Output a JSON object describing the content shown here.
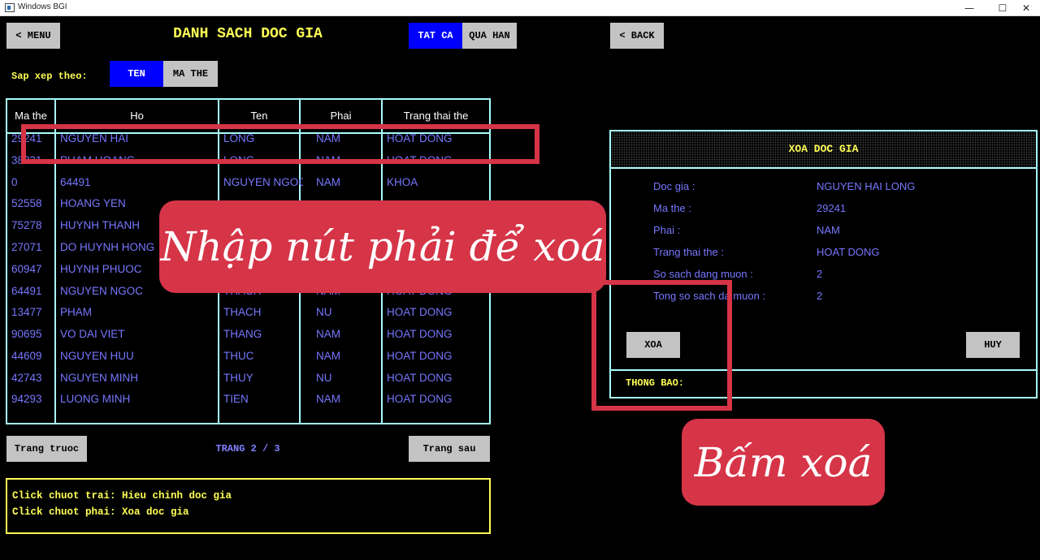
{
  "window": {
    "title": "Windows BGI",
    "minimize": "—",
    "maximize": "☐",
    "close": "✕"
  },
  "nav": {
    "menu_label": "< MENU",
    "back_label": "< BACK"
  },
  "heading": "DANH SACH DOC GIA",
  "filter": {
    "all_label": "TAT CA",
    "overdue_label": "QUA HAN",
    "active": "TAT CA"
  },
  "sort": {
    "label": "Sap xep theo:",
    "name_label": "TEN",
    "card_label": "MA THE",
    "active": "TEN"
  },
  "table": {
    "headers": [
      "Ma the",
      "Ho",
      "Ten",
      "Phai",
      "Trang thai the"
    ],
    "rows": [
      [
        "29241",
        "NGUYEN HAI",
        "LONG",
        "NAM",
        "HOAT DONG"
      ],
      [
        "38231",
        "PHAM HOANG",
        "LONG",
        "NAM",
        "HOAT DONG"
      ],
      [
        "0",
        "64491",
        "NGUYEN NGOC",
        "NAM",
        "KHOA"
      ],
      [
        "52558",
        "HOANG YEN",
        "",
        "",
        ""
      ],
      [
        "75278",
        "HUYNH THANH",
        "",
        "",
        ""
      ],
      [
        "27071",
        "DO HUYNH HONG",
        "",
        "",
        ""
      ],
      [
        "60947",
        "HUYNH PHUOC",
        "",
        "",
        ""
      ],
      [
        "64491",
        "NGUYEN NGOC",
        "THACH",
        "NAM",
        "HOAT DONG"
      ],
      [
        "13477",
        "PHAM",
        "THACH",
        "NU",
        "HOAT DONG"
      ],
      [
        "90695",
        "VO DAI VIET",
        "THANG",
        "NAM",
        "HOAT DONG"
      ],
      [
        "44609",
        "NGUYEN HUU",
        "THUC",
        "NAM",
        "HOAT DONG"
      ],
      [
        "42743",
        "NGUYEN MINH",
        "THUY",
        "NU",
        "HOAT DONG"
      ],
      [
        "94293",
        "LUONG MINH",
        "TIEN",
        "NAM",
        "HOAT DONG"
      ]
    ]
  },
  "pager": {
    "prev_label": "Trang truoc",
    "next_label": "Trang sau",
    "page_text": "TRANG 2 / 3"
  },
  "help": {
    "line1": "Click chuot trai: Hieu chinh doc gia",
    "line2": "Click chuot phai: Xoa doc gia"
  },
  "dialog": {
    "title": "XOA DOC GIA",
    "fields": [
      {
        "label": "Doc gia :",
        "value": "NGUYEN HAI LONG"
      },
      {
        "label": "Ma the :",
        "value": "29241"
      },
      {
        "label": "Phai :",
        "value": "NAM"
      },
      {
        "label": "Trang thai the :",
        "value": "HOAT DONG"
      },
      {
        "label": "So sach dang muon :",
        "value": "2"
      },
      {
        "label": "Tong so sach da muon :",
        "value": "2"
      }
    ],
    "delete_label": "XOA",
    "cancel_label": "HUY",
    "notice_label": "THONG BAO:"
  },
  "annotations": {
    "right_click_hint": "Nhập nút phải để xoá",
    "press_delete_hint": "Bấm xoá"
  },
  "colors": {
    "background": "#000000",
    "title_yellow": "#ffff55",
    "text_blue": "#7777ff",
    "frame_cyan": "#a8fcfc",
    "button_gray": "#c3c3c3",
    "active_blue": "#0000ff",
    "annotation_red": "#d63447"
  }
}
